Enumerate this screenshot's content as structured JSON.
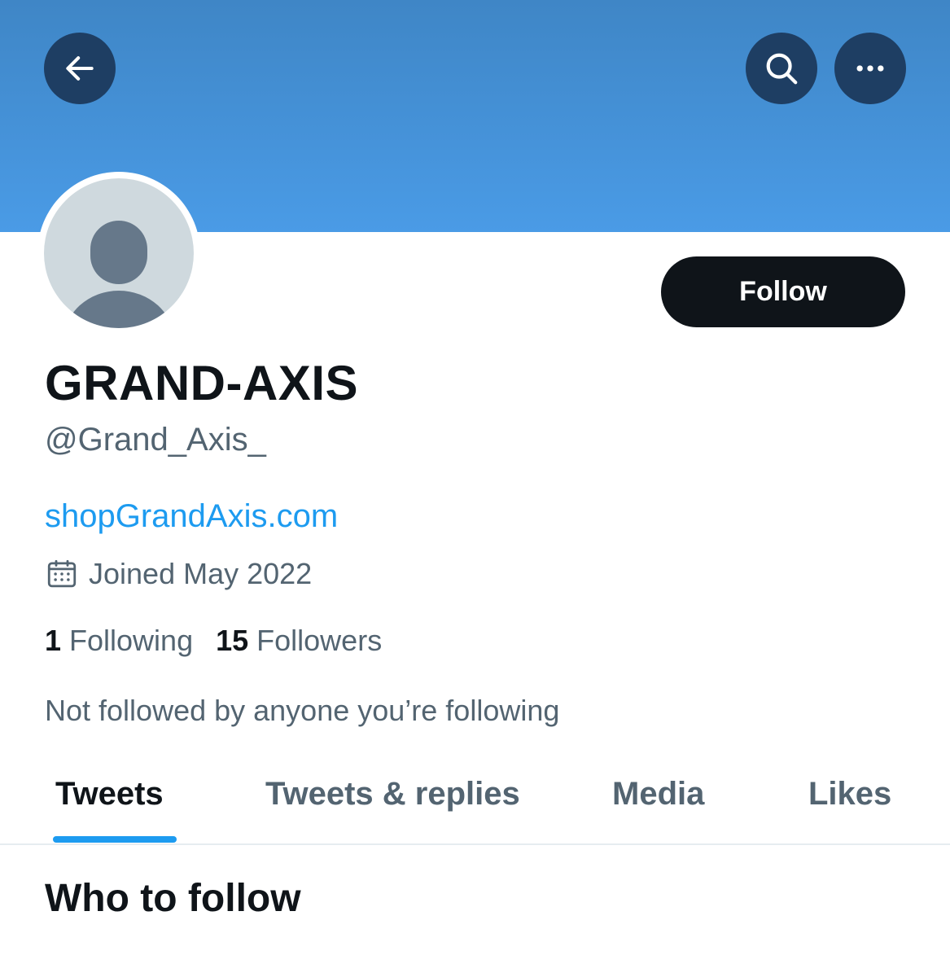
{
  "header": {
    "back_icon": "arrow-left-icon",
    "search_icon": "search-icon",
    "more_icon": "more-horizontal-icon",
    "banner_color": "#4a9be6"
  },
  "profile": {
    "avatar_icon": "default-avatar-icon",
    "follow_label": "Follow",
    "name": "GRAND-AXIS",
    "handle": "@Grand_Axis_",
    "website": "shopGrandAxis.com",
    "calendar_icon": "calendar-icon",
    "joined": "Joined May 2022",
    "following_count": "1",
    "following_label": "Following",
    "followers_count": "15",
    "followers_label": "Followers",
    "followed_by": "Not followed by anyone you’re following"
  },
  "tabs": [
    {
      "label": "Tweets",
      "active": true
    },
    {
      "label": "Tweets & replies",
      "active": false
    },
    {
      "label": "Media",
      "active": false
    },
    {
      "label": "Likes",
      "active": false
    }
  ],
  "section": {
    "who_to_follow": "Who to follow"
  },
  "colors": {
    "accent": "#1d9bf0",
    "text_primary": "#0f1419",
    "text_secondary": "#536471"
  }
}
